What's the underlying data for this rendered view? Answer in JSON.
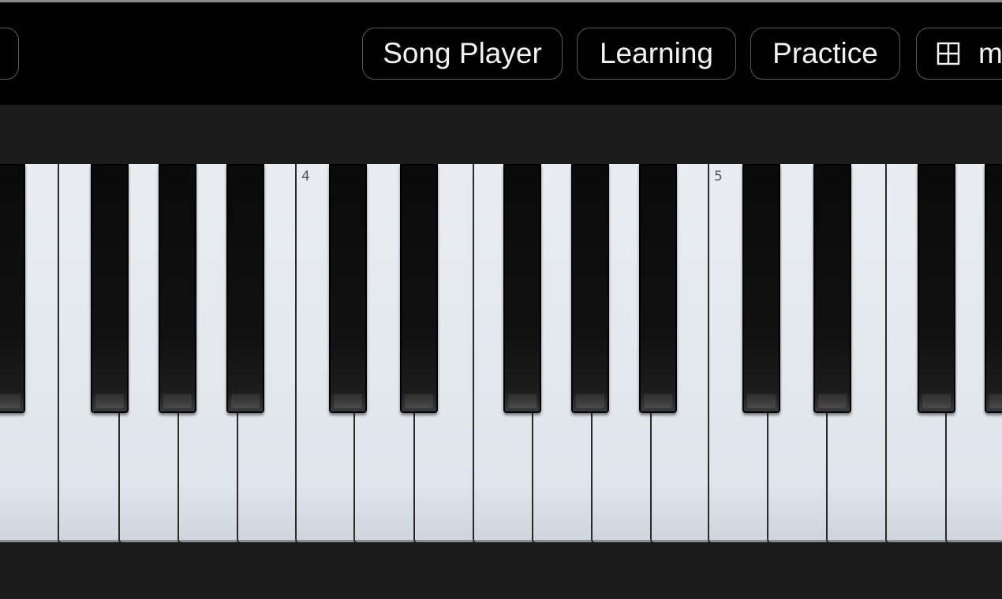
{
  "nav": {
    "song_player_label": "Song Player",
    "learning_label": "Learning",
    "practice_label": "Practice",
    "mode_label": "m"
  },
  "icons": {
    "mode": "grid-icon"
  },
  "keyboard": {
    "octave_labels": [
      "4",
      "5"
    ]
  },
  "colors": {
    "header_bg": "#000000",
    "page_bg": "#1b1b1b",
    "white_key": "#e4e9ef",
    "black_key": "#0d0d0d"
  }
}
